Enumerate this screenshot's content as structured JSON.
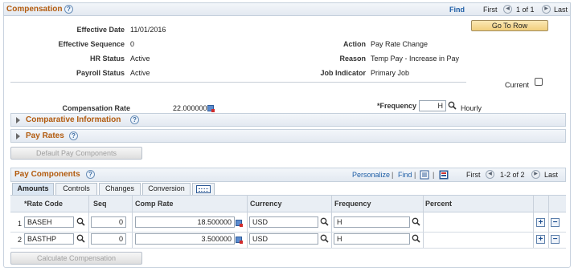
{
  "compensation": {
    "title": "Compensation",
    "find": "Find",
    "first": "First",
    "paging": "1 of 1",
    "last": "Last",
    "go_to_row": "Go To Row",
    "effective_date_label": "Effective Date",
    "effective_date": "11/01/2016",
    "effective_sequence_label": "Effective Sequence",
    "effective_sequence": "0",
    "hr_status_label": "HR Status",
    "hr_status": "Active",
    "payroll_status_label": "Payroll Status",
    "payroll_status": "Active",
    "action_label": "Action",
    "action": "Pay Rate Change",
    "reason_label": "Reason",
    "reason": "Temp Pay - Increase in Pay",
    "job_indicator_label": "Job Indicator",
    "job_indicator": "Primary Job",
    "current_label": "Current",
    "comp_rate_label": "Compensation Rate",
    "comp_rate": "22.000000",
    "frequency_label": "*Frequency",
    "frequency": "H",
    "frequency_desc": "Hourly"
  },
  "comparative": {
    "title": "Comparative Information"
  },
  "pay_rates": {
    "title": "Pay Rates"
  },
  "default_pay_components": "Default Pay Components",
  "pay_components": {
    "title": "Pay Components",
    "personalize": "Personalize",
    "find": "Find",
    "first": "First",
    "paging": "1-2 of 2",
    "last": "Last",
    "tabs": [
      "Amounts",
      "Controls",
      "Changes",
      "Conversion"
    ],
    "columns": [
      "*Rate Code",
      "Seq",
      "Comp Rate",
      "Currency",
      "Frequency",
      "Percent"
    ],
    "rows": [
      {
        "num": "1",
        "rate_code": "BASEH",
        "seq": "0",
        "comp_rate": "18.500000",
        "currency": "USD",
        "frequency": "H"
      },
      {
        "num": "2",
        "rate_code": "BASTHP",
        "seq": "0",
        "comp_rate": "3.500000",
        "currency": "USD",
        "frequency": "H"
      }
    ]
  },
  "calculate_compensation": "Calculate Compensation"
}
